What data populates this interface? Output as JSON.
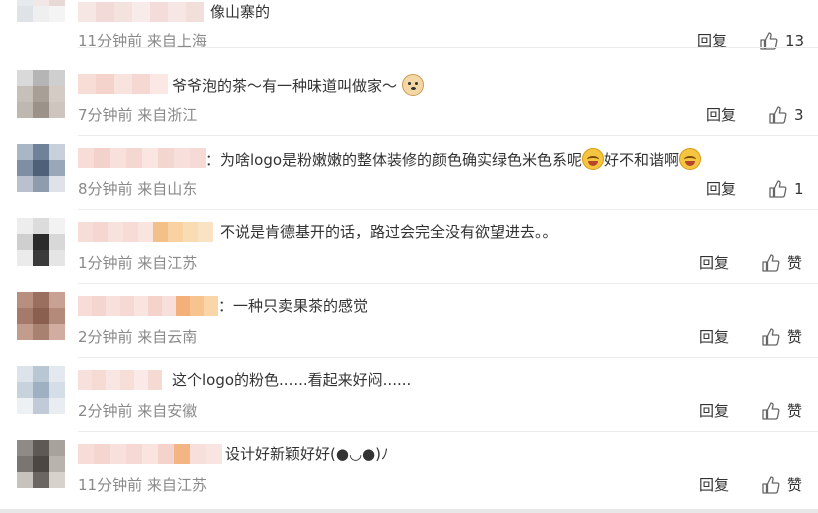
{
  "comments": [
    {
      "text": "像山寨的",
      "time": "11分钟前 来自上海",
      "reply_label": "回复",
      "like_label": "13",
      "avatar_colors": [
        "#c9cfd8",
        "#7f93aa",
        "#d7dbe2",
        "#e6e9ee",
        "#f2e7e4",
        "#e9d9d6",
        "#dfe3e8",
        "#efefef",
        "#f4f4f4"
      ],
      "name_colors": [
        "#f6e6e4",
        "#f1dad7",
        "#f4e2df",
        "#f7ecea",
        "#f3dcd9",
        "#f6e7e5",
        "#f2dedb"
      ]
    },
    {
      "text": "爷爷泡的茶～有一种味道叫做家～",
      "emoji": "dog-emoji",
      "time": "7分钟前 来自浙江",
      "reply_label": "回复",
      "like_label": "3",
      "avatar_colors": [
        "#d9d9d9",
        "#b5b5b5",
        "#cfcfcf",
        "#c7c0b8",
        "#a89f96",
        "#d3cbc4",
        "#bfb8b1",
        "#9b928a",
        "#cdc5be"
      ],
      "name_colors": [
        "#f8dcd6",
        "#f5d3cd",
        "#f9e3de",
        "#f6d8d2",
        "#fbe7e3"
      ]
    },
    {
      "text": "：为啥logo是粉嫩嫩的整体装修的颜色确实绿色米色系呢",
      "text_tail": "好不和谐啊",
      "time": "8分钟前 来自山东",
      "reply_label": "回复",
      "like_label": "1",
      "avatar_colors": [
        "#a9b6c6",
        "#6f829a",
        "#c8d0db",
        "#7e8ea3",
        "#4f6079",
        "#9aa7b8",
        "#b8c1cd",
        "#8f9cae",
        "#dfe3e9"
      ],
      "name_colors": [
        "#f7dcd7",
        "#f3d2cc",
        "#f8e1dd",
        "#f5d7d2",
        "#f9e5e2",
        "#f4d6d0",
        "#f7dfdb",
        "#f6dad5"
      ]
    },
    {
      "text": "不说是肯德基开的话，路过会完全没有欲望进去。。",
      "time": "1分钟前 来自江苏",
      "reply_label": "回复",
      "like_label": "赞",
      "avatar_colors": [
        "#ededed",
        "#dcdcdc",
        "#f2f2f2",
        "#cfcfcf",
        "#2b2b2b",
        "#d8d8d8",
        "#ebebeb",
        "#3a3a3a",
        "#e5e5e5"
      ],
      "name_colors": [
        "#f7ddd8",
        "#f5d6d0",
        "#f8e2de",
        "#f6dbd6",
        "#f9e4e0",
        "#f4c08a",
        "#f8d2a0",
        "#f9dcb3",
        "#fae3c4"
      ]
    },
    {
      "text": "：一种只卖果茶的感觉",
      "time": "2分钟前 来自云南",
      "reply_label": "回复",
      "like_label": "赞",
      "avatar_colors": [
        "#b88f7f",
        "#9a6f60",
        "#c7a294",
        "#a57a6a",
        "#8b5f50",
        "#b48b7b",
        "#c29c8d",
        "#a98171",
        "#d0ada0"
      ],
      "name_colors": [
        "#f7dcd7",
        "#f5d5cf",
        "#f8e1dd",
        "#f6d9d4",
        "#f9e4e0",
        "#f4d3cd",
        "#f7dfdb",
        "#f3b07a",
        "#f7c48f",
        "#f9d5a8"
      ]
    },
    {
      "text": "这个logo的粉色......看起来好闷......",
      "time": "2分钟前 来自安徽",
      "reply_label": "回复",
      "like_label": "赞",
      "avatar_colors": [
        "#dde3ea",
        "#b9c6d4",
        "#e4e9ef",
        "#c8d2dd",
        "#9fb0c3",
        "#d5dde6",
        "#eef1f4",
        "#c0cbd7",
        "#e9edf2"
      ],
      "name_colors": [
        "#f8e1dc",
        "#f6dad4",
        "#f9e6e2",
        "#f7ded9",
        "#fae9e6",
        "#f5d9d3"
      ]
    },
    {
      "text": "设计好新颖好好(●◡●)ﾉ",
      "time": "11分钟前 来自江苏",
      "reply_label": "回复",
      "like_label": "赞",
      "avatar_colors": [
        "#8f8a86",
        "#5f5955",
        "#a8a29d",
        "#7b7571",
        "#4d4743",
        "#b9b3ae",
        "#c8c2bd",
        "#6c6662",
        "#d8d2cd"
      ],
      "name_colors": [
        "#f7dcd7",
        "#f5d5cf",
        "#f8e1dd",
        "#f6d9d4",
        "#f9e4e0",
        "#f4d3cd",
        "#f3b583",
        "#f7dfdb",
        "#f8e4e1"
      ]
    }
  ]
}
